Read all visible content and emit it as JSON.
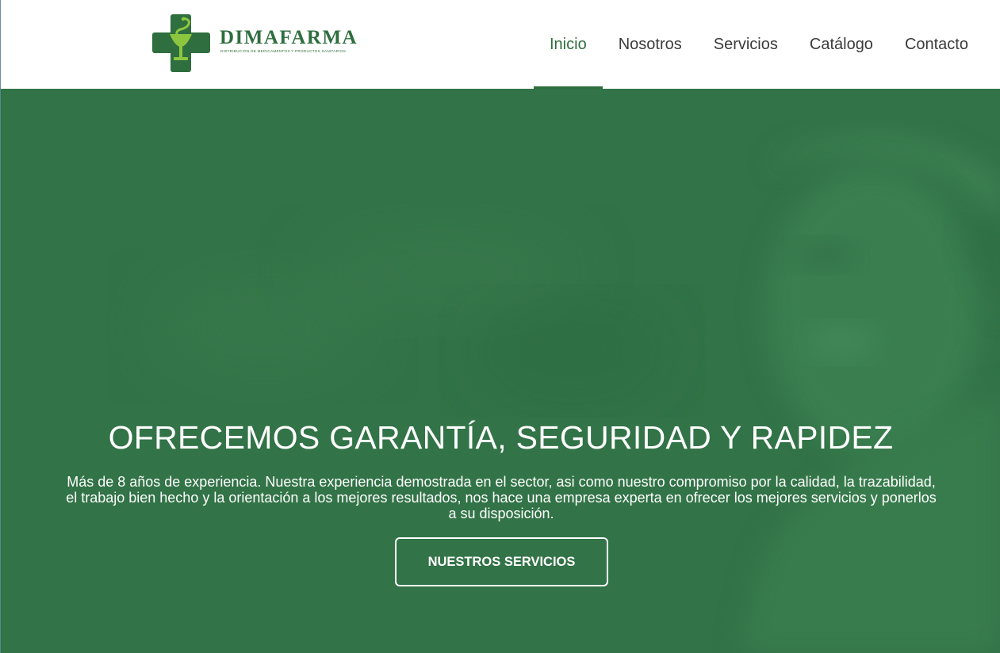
{
  "brand": {
    "name": "DIMAFARMA",
    "tagline": "DISTRIBUCIÓN DE MEDICAMENTOS Y PRODUCTOS SANITARIOS",
    "logo_icon": "pharmacy-cross-bowl-of-hygieia",
    "primary_color": "#2f6e3e",
    "accent_color": "#8cc63f"
  },
  "nav": {
    "items": [
      {
        "label": "Inicio",
        "active": true
      },
      {
        "label": "Nosotros",
        "active": false
      },
      {
        "label": "Servicios",
        "active": false
      },
      {
        "label": "Catálogo",
        "active": false
      },
      {
        "label": "Contacto",
        "active": false
      }
    ]
  },
  "hero": {
    "title": "OFRECEMOS GARANTÍA, SEGURIDAD Y RAPIDEZ",
    "text": "Más de 8 años de experiencia. Nuestra experiencia demostrada en el sector, asi como nuestro compromiso por la calidad, la trazabilidad, el trabajo bien hecho y la orientación a los mejores resultados, nos hace una empresa experta en ofrecer los mejores servicios y ponerlos a su disposición.",
    "button_label": "NUESTROS SERVICIOS",
    "background_color": "#327347"
  }
}
